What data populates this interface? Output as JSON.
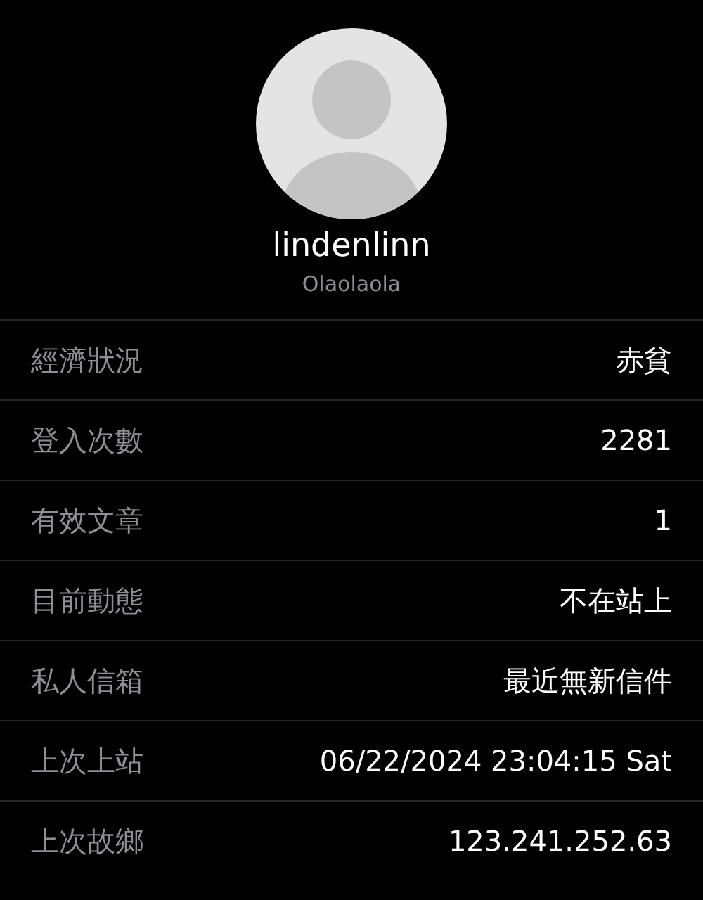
{
  "profile": {
    "username": "lindenlinn",
    "nickname": "Olaolaola"
  },
  "rows": [
    {
      "label": "經濟狀況",
      "value": "赤貧"
    },
    {
      "label": "登入次數",
      "value": "2281"
    },
    {
      "label": "有效文章",
      "value": "1"
    },
    {
      "label": "目前動態",
      "value": "不在站上"
    },
    {
      "label": "私人信箱",
      "value": "最近無新信件"
    },
    {
      "label": "上次上站",
      "value": "06/22/2024 23:04:15 Sat"
    },
    {
      "label": "上次故鄉",
      "value": "123.241.252.63"
    }
  ]
}
